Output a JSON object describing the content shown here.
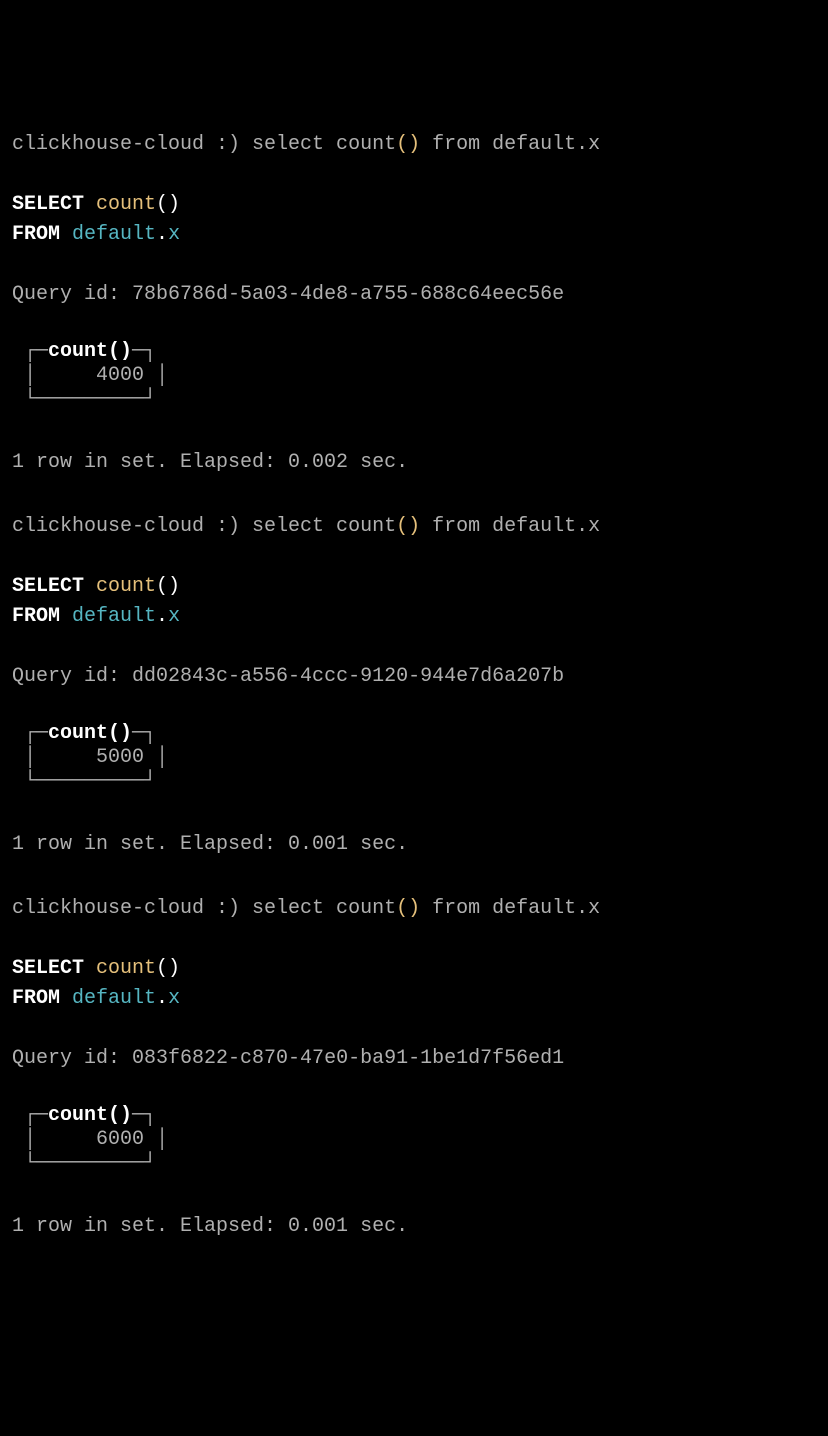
{
  "prompt_prefix": "clickhouse-cloud :) ",
  "input_cmd": {
    "prefix": "select count",
    "parens": "()",
    "suffix": " from default.x"
  },
  "parsed": {
    "select": "SELECT",
    "count": "count",
    "from": "FROM",
    "schema": "default",
    "table": "x"
  },
  "query_id_label": "Query id: ",
  "result_col_header": "count()",
  "rows_prefix": "1 row in set. Elapsed: ",
  "rows_suffix": " sec.",
  "queries": [
    {
      "query_id": "78b6786d-5a03-4de8-a755-688c64eec56e",
      "result": "4000",
      "elapsed": "0.002"
    },
    {
      "query_id": "dd02843c-a556-4ccc-9120-944e7d6a207b",
      "result": "5000",
      "elapsed": "0.001"
    },
    {
      "query_id": "083f6822-c870-47e0-ba91-1be1d7f56ed1",
      "result": "6000",
      "elapsed": "0.001"
    }
  ]
}
